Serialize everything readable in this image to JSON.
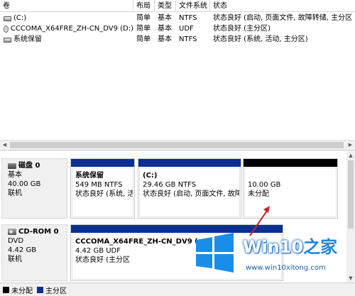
{
  "volume_list": {
    "columns": [
      "卷",
      "布局",
      "类型",
      "文件系统",
      "状态"
    ],
    "rows": [
      {
        "icon": "drive-icon",
        "volume": "(C:)",
        "layout": "简单",
        "type": "基本",
        "fs": "NTFS",
        "status": "状态良好 (启动, 页面文件, 故障转储, 主分区"
      },
      {
        "icon": "cd-drive-icon",
        "volume": "CCCOMA_X64FRE_ZH-CN_DV9 (D:)",
        "layout": "简单",
        "type": "基本",
        "fs": "UDF",
        "status": "状态良好 (主分区)"
      },
      {
        "icon": "drive-icon",
        "volume": "系统保留",
        "layout": "简单",
        "type": "基本",
        "fs": "NTFS",
        "status": "状态良好 (系统, 活动, 主分区)"
      }
    ]
  },
  "disks": [
    {
      "name": "磁盘 0",
      "type": "基本",
      "size": "40.00 GB",
      "state": "联机",
      "partitions": [
        {
          "title": "系统保留",
          "size_fs": "549 MB NTFS",
          "status": "状态良好 (系统, 活",
          "kind": "primary"
        },
        {
          "title": "(C:)",
          "size_fs": "29.46 GB NTFS",
          "status": "状态良好 (启动, 页面文件, 故障",
          "kind": "primary"
        },
        {
          "title": "",
          "size_fs": "10.00 GB",
          "status": "未分配",
          "kind": "unallocated"
        }
      ]
    },
    {
      "name": "CD-ROM 0",
      "type": "DVD",
      "size": "4.42 GB",
      "state": "联机",
      "partitions": [
        {
          "title": "CCCOMA_X64FRE_ZH-CN_DV9 (",
          "size_fs": "4.42 GB UDF",
          "status": "状态良好 (主分区",
          "kind": "primary"
        }
      ]
    }
  ],
  "legend": {
    "items": [
      {
        "label": "未分配",
        "color": "#000000"
      },
      {
        "label": "主分区",
        "color": "#0b2f8f"
      }
    ]
  },
  "watermark": {
    "brand_latin": "Win10",
    "brand_zh": "之家",
    "url": "www.win10xitong.com"
  },
  "colors": {
    "primary_partition": "#0b2f8f",
    "unallocated": "#000000",
    "annotation_arrow": "#c0282d"
  }
}
